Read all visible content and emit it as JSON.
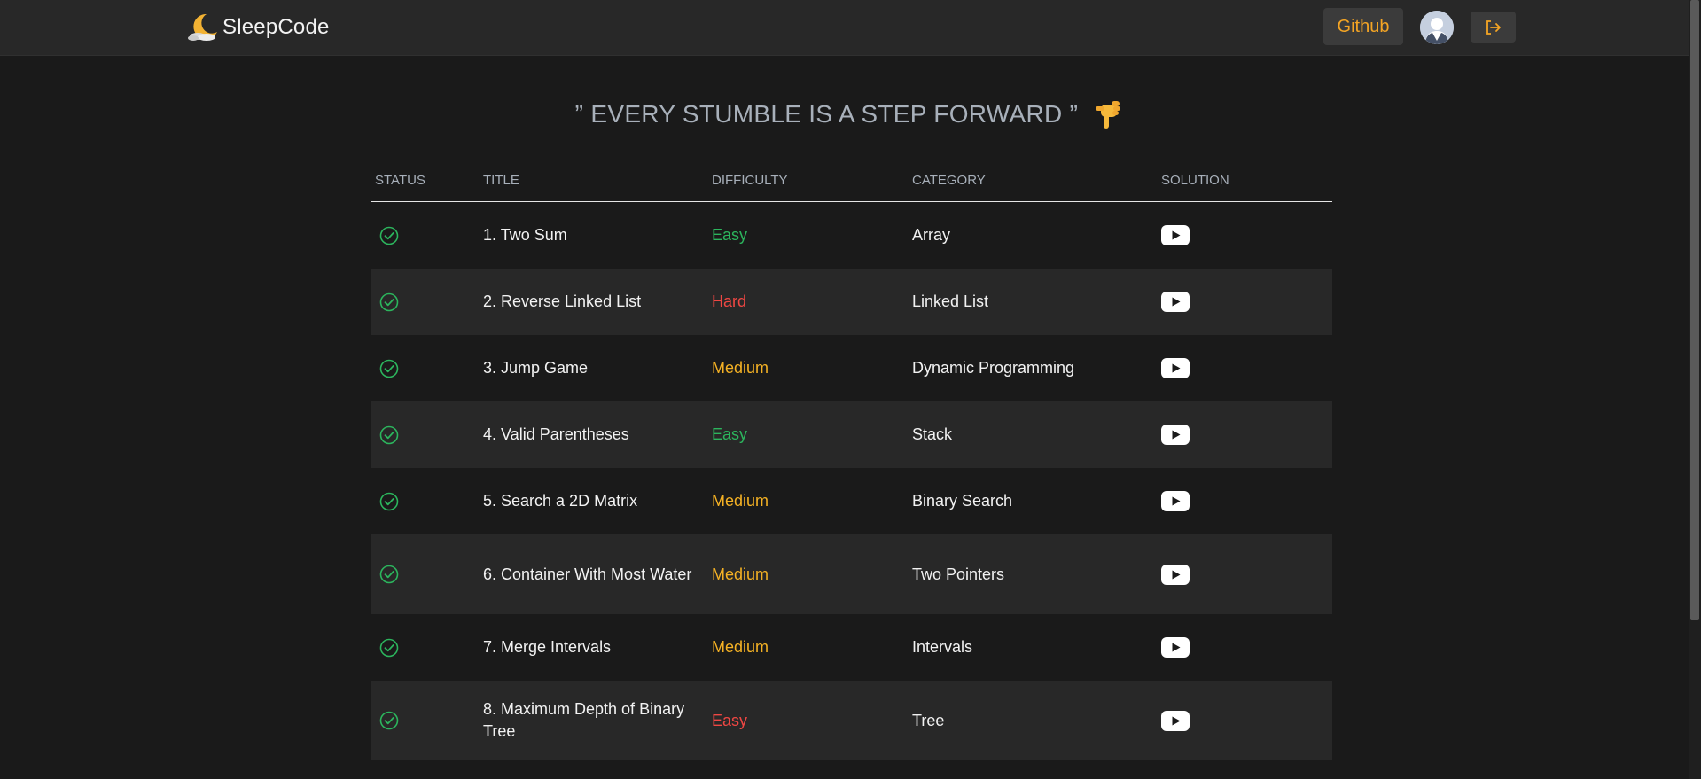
{
  "brand": {
    "name": "SleepCode",
    "logo_icon": "crescent-moon-icon"
  },
  "nav": {
    "github_label": "Github",
    "avatar_icon": "user-avatar-icon",
    "logout_icon": "logout-icon"
  },
  "quote": {
    "text": "” EVERY STUMBLE IS A STEP FORWARD ”",
    "emoji": "pointing-down-hand-icon"
  },
  "colors": {
    "easy": "#2cb55d",
    "medium": "#f5b224",
    "hard": "#ef4743",
    "accent": "#f5a524"
  },
  "table": {
    "headers": {
      "status": "STATUS",
      "title": "TITLE",
      "difficulty": "DIFFICULTY",
      "category": "CATEGORY",
      "solution": "SOLUTION"
    },
    "rows": [
      {
        "status": "solved",
        "title": "1. Two Sum",
        "difficulty": "Easy",
        "difficulty_color": "#2cb55d",
        "category": "Array",
        "solution_icon": "youtube-icon"
      },
      {
        "status": "solved",
        "title": "2. Reverse Linked List",
        "difficulty": "Hard",
        "difficulty_color": "#ef4743",
        "category": "Linked List",
        "solution_icon": "youtube-icon"
      },
      {
        "status": "solved",
        "title": "3. Jump Game",
        "difficulty": "Medium",
        "difficulty_color": "#f5b224",
        "category": "Dynamic Programming",
        "solution_icon": "youtube-icon"
      },
      {
        "status": "solved",
        "title": "4. Valid Parentheses",
        "difficulty": "Easy",
        "difficulty_color": "#2cb55d",
        "category": "Stack",
        "solution_icon": "youtube-icon"
      },
      {
        "status": "solved",
        "title": "5. Search a 2D Matrix",
        "difficulty": "Medium",
        "difficulty_color": "#f5b224",
        "category": "Binary Search",
        "solution_icon": "youtube-icon"
      },
      {
        "status": "solved",
        "title": "6. Container With Most Water",
        "difficulty": "Medium",
        "difficulty_color": "#f5b224",
        "category": "Two Pointers",
        "solution_icon": "youtube-icon"
      },
      {
        "status": "solved",
        "title": "7. Merge Intervals",
        "difficulty": "Medium",
        "difficulty_color": "#f5b224",
        "category": "Intervals",
        "solution_icon": "youtube-icon"
      },
      {
        "status": "solved",
        "title": "8. Maximum Depth of Binary Tree",
        "difficulty": "Easy",
        "difficulty_color": "#ef4743",
        "category": "Tree",
        "solution_icon": "youtube-icon"
      }
    ]
  }
}
